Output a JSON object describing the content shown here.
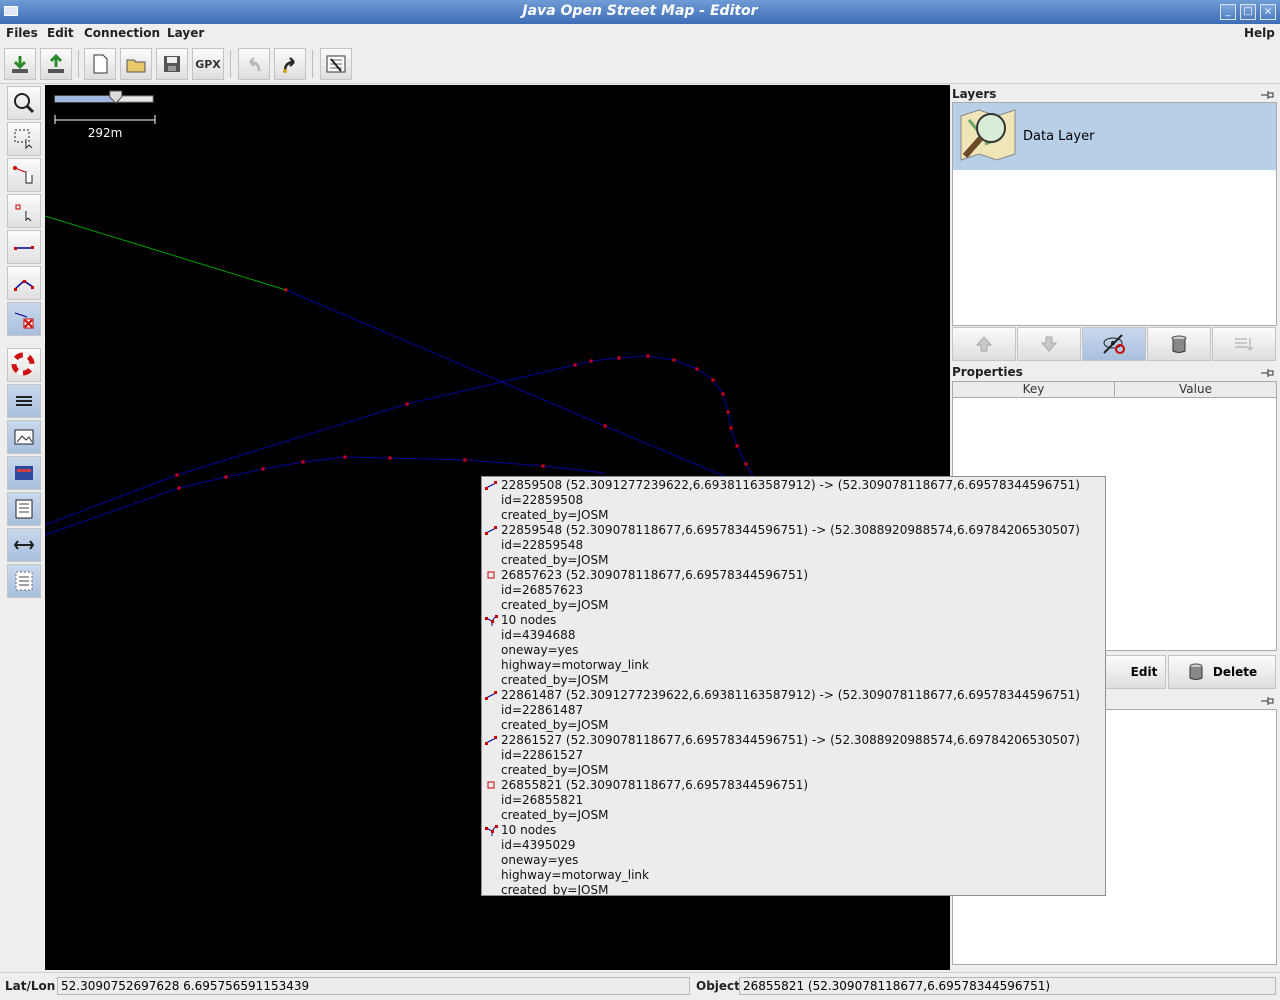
{
  "window": {
    "title": "Java Open Street Map - Editor"
  },
  "menubar": {
    "files": "Files",
    "edit": "Edit",
    "connection": "Connection",
    "layer": "Layer",
    "help": "Help"
  },
  "toolbar": {
    "buttons": [
      "download-icon",
      "upload-icon",
      "new-file-icon",
      "open-folder-icon",
      "save-icon",
      "gpx-export-icon",
      "undo-icon",
      "redo-icon",
      "preferences-icon"
    ],
    "gpx_label": "GPX"
  },
  "left_tools": [
    "zoom-icon",
    "select-icon",
    "move-icon",
    "add-node-icon",
    "add-segment-icon",
    "add-way-icon",
    "delete-icon",
    "lifesaver-icon",
    "layers-toggle-icon",
    "image-icon",
    "conflict-icon",
    "commands-icon",
    "history-icon",
    "selection-list-icon"
  ],
  "map": {
    "scale_label": "292m",
    "zoom_slider": 0.62
  },
  "popup": {
    "rows": [
      {
        "type": "segment",
        "text": "22859508 (52.3091277239622,6.69381163587912) -> (52.309078118677,6.69578344596751)"
      },
      {
        "type": "tag",
        "text": "id=22859508"
      },
      {
        "type": "tag",
        "text": "created_by=JOSM"
      },
      {
        "type": "segment",
        "text": "22859548 (52.309078118677,6.69578344596751) -> (52.3088920988574,6.69784206530507)"
      },
      {
        "type": "tag",
        "text": "id=22859548"
      },
      {
        "type": "tag",
        "text": "created_by=JOSM"
      },
      {
        "type": "node",
        "text": "26857623 (52.309078118677,6.69578344596751)"
      },
      {
        "type": "tag",
        "text": "id=26857623"
      },
      {
        "type": "tag",
        "text": "created_by=JOSM"
      },
      {
        "type": "way",
        "text": "10 nodes"
      },
      {
        "type": "tag",
        "text": "id=4394688"
      },
      {
        "type": "tag",
        "text": "oneway=yes"
      },
      {
        "type": "tag",
        "text": "highway=motorway_link"
      },
      {
        "type": "tag",
        "text": "created_by=JOSM"
      },
      {
        "type": "segment",
        "text": "22861487 (52.3091277239622,6.69381163587912) -> (52.309078118677,6.69578344596751)"
      },
      {
        "type": "tag",
        "text": "id=22861487"
      },
      {
        "type": "tag",
        "text": "created_by=JOSM"
      },
      {
        "type": "segment",
        "text": "22861527 (52.309078118677,6.69578344596751) -> (52.3088920988574,6.69784206530507)"
      },
      {
        "type": "tag",
        "text": "id=22861527"
      },
      {
        "type": "tag",
        "text": "created_by=JOSM"
      },
      {
        "type": "node",
        "text": "26855821 (52.309078118677,6.69578344596751)"
      },
      {
        "type": "tag",
        "text": "id=26855821"
      },
      {
        "type": "tag",
        "text": "created_by=JOSM"
      },
      {
        "type": "way",
        "text": "10 nodes"
      },
      {
        "type": "tag",
        "text": "id=4395029"
      },
      {
        "type": "tag",
        "text": "oneway=yes"
      },
      {
        "type": "tag",
        "text": "highway=motorway_link"
      },
      {
        "type": "tag",
        "text": "created_by=JOSM"
      }
    ]
  },
  "layers_panel": {
    "title": "Layers",
    "layer_name": "Data Layer"
  },
  "properties_panel": {
    "title": "Properties",
    "col_key": "Key",
    "col_value": "Value",
    "edit_label": "Edit",
    "delete_label": "Delete"
  },
  "status": {
    "latlon_label": "Lat/Lon",
    "latlon_value": "52.3090752697628 6.695756591153439",
    "object_label": "Object",
    "object_value": "26855821 (52.309078118677,6.69578344596751)"
  },
  "colors": {
    "title_bar": "#4f7fc2",
    "map_bg": "#000000",
    "segment": "#00009a",
    "node": "#ff0000",
    "incomplete": "#00a000",
    "selection": "#b8cfe8"
  }
}
